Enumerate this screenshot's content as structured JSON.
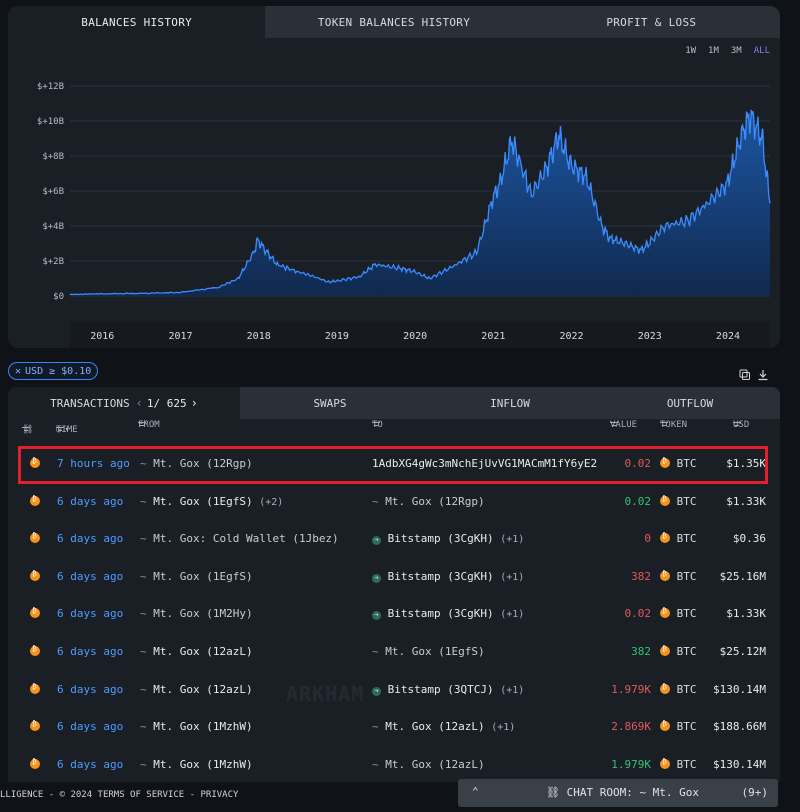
{
  "chart_tabs": [
    {
      "label": "BALANCES HISTORY"
    },
    {
      "label": "TOKEN BALANCES HISTORY"
    },
    {
      "label": "PROFIT & LOSS"
    }
  ],
  "ranges": [
    "1W",
    "1M",
    "3M",
    "ALL"
  ],
  "active_range": "ALL",
  "chart_data": {
    "type": "area",
    "title": "",
    "xlabel": "",
    "ylabel": "",
    "y_ticks": [
      "$0",
      "$+2B",
      "$+4B",
      "$+6B",
      "$+8B",
      "$+10B",
      "$+12B"
    ],
    "x_ticks": [
      "2016",
      "2017",
      "2018",
      "2019",
      "2020",
      "2021",
      "2022",
      "2023",
      "2024"
    ],
    "ylim": [
      0,
      12.5
    ],
    "x": [
      2015.6,
      2016.0,
      2016.5,
      2017.0,
      2017.5,
      2017.75,
      2017.95,
      2018.0,
      2018.1,
      2018.25,
      2018.5,
      2018.9,
      2019.0,
      2019.3,
      2019.5,
      2019.8,
      2020.0,
      2020.2,
      2020.5,
      2020.8,
      2021.0,
      2021.1,
      2021.25,
      2021.5,
      2021.7,
      2021.85,
      2022.0,
      2022.2,
      2022.4,
      2022.5,
      2022.7,
      2022.9,
      2023.0,
      2023.2,
      2023.5,
      2023.8,
      2024.0,
      2024.2,
      2024.3,
      2024.45,
      2024.55
    ],
    "y": [
      0.1,
      0.12,
      0.15,
      0.2,
      0.5,
      1.0,
      2.5,
      3.2,
      2.6,
      1.8,
      1.4,
      0.8,
      0.85,
      1.1,
      1.8,
      1.6,
      1.4,
      1.0,
      1.7,
      2.5,
      5.5,
      6.5,
      8.9,
      5.8,
      7.4,
      9.2,
      7.5,
      6.8,
      4.0,
      3.3,
      3.0,
      2.6,
      3.0,
      4.0,
      4.3,
      5.5,
      6.4,
      9.4,
      10.3,
      9.0,
      5.3
    ]
  },
  "filter_chip": {
    "label": "USD ≥ $0.10"
  },
  "tx_tabs": {
    "transactions": "TRANSACTIONS",
    "page": "1/ 625",
    "swaps": "SWAPS",
    "inflow": "INFLOW",
    "outflow": "OUTFLOW"
  },
  "columns": {
    "time": "TIME",
    "from": "FROM",
    "to": "TO",
    "value": "VALUE",
    "token": "TOKEN",
    "usd": "USD"
  },
  "rows": [
    {
      "time": "7 hours ago",
      "from": "Mt. Gox (12Rgp)",
      "from_extra": "",
      "to": "1AdbXG4gWc3mNchEjUvVG1MACmM1fY6yE2",
      "to_extra": "",
      "value": "0.02",
      "value_color": "red",
      "token": "BTC",
      "usd": "$1.35K"
    },
    {
      "time": "6 days ago",
      "from": "Mt. Gox (1EgfS)",
      "from_extra": "(+2)",
      "to": "Mt. Gox (12Rgp)",
      "to_extra": "",
      "value": "0.02",
      "value_color": "green",
      "token": "BTC",
      "usd": "$1.33K"
    },
    {
      "time": "6 days ago",
      "from": "Mt. Gox: Cold Wallet (1Jbez)",
      "from_extra": "",
      "to": "Bitstamp (3CgKH)",
      "to_extra": "(+1)",
      "value": "0",
      "value_color": "red",
      "token": "BTC",
      "usd": "$0.36"
    },
    {
      "time": "6 days ago",
      "from": "Mt. Gox (1EgfS)",
      "from_extra": "",
      "to": "Bitstamp (3CgKH)",
      "to_extra": "(+1)",
      "value": "382",
      "value_color": "red",
      "token": "BTC",
      "usd": "$25.16M"
    },
    {
      "time": "6 days ago",
      "from": "Mt. Gox (1M2Hy)",
      "from_extra": "",
      "to": "Bitstamp (3CgKH)",
      "to_extra": "(+1)",
      "value": "0.02",
      "value_color": "red",
      "token": "BTC",
      "usd": "$1.33K"
    },
    {
      "time": "6 days ago",
      "from": "Mt. Gox (12azL)",
      "from_extra": "",
      "to": "Mt. Gox (1EgfS)",
      "to_extra": "",
      "value": "382",
      "value_color": "green",
      "token": "BTC",
      "usd": "$25.12M"
    },
    {
      "time": "6 days ago",
      "from": "Mt. Gox (12azL)",
      "from_extra": "",
      "to": "Bitstamp (3QTCJ)",
      "to_extra": "(+1)",
      "value": "1.979K",
      "value_color": "red",
      "token": "BTC",
      "usd": "$130.14M"
    },
    {
      "time": "6 days ago",
      "from": "Mt. Gox (1MzhW)",
      "from_extra": "",
      "to": "Mt. Gox (12azL)",
      "to_extra": "(+1)",
      "value": "2.869K",
      "value_color": "red",
      "token": "BTC",
      "usd": "$188.66M"
    },
    {
      "time": "6 days ago",
      "from": "Mt. Gox (1MzhW)",
      "from_extra": "",
      "to": "Mt. Gox (12azL)",
      "to_extra": "",
      "value": "1.979K",
      "value_color": "green",
      "token": "BTC",
      "usd": "$130.14M"
    }
  ],
  "watermark": "ARKHAM",
  "footer": {
    "text": "LLIGENCE - © 2024  TERMS OF SERVICE - PRIVACY"
  },
  "chat": {
    "label": "CHAT ROOM: ~ Mt. Gox",
    "count": "(9+)"
  }
}
